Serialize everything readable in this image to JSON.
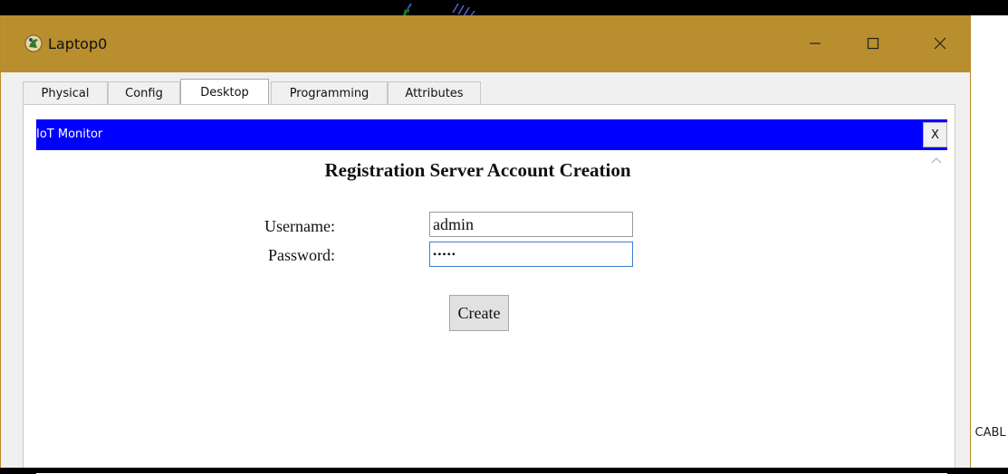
{
  "window": {
    "title": "Laptop0",
    "controls": {
      "minimize": "minimize",
      "maximize": "maximize",
      "close": "close"
    }
  },
  "tabs": [
    {
      "label": "Physical"
    },
    {
      "label": "Config"
    },
    {
      "label": "Desktop",
      "active": true
    },
    {
      "label": "Programming"
    },
    {
      "label": "Attributes"
    }
  ],
  "monitor": {
    "title": "IoT Monitor",
    "close_label": "X"
  },
  "page": {
    "heading": "Registration Server Account Creation",
    "username_label": "Username:",
    "username_value": "admin",
    "password_label": "Password:",
    "password_value": "•••••",
    "create_label": "Create"
  },
  "background": {
    "partial_text": "\\ CABL"
  },
  "colors": {
    "titlebar": "#b98e2e",
    "monitor_header": "#0000ff"
  }
}
